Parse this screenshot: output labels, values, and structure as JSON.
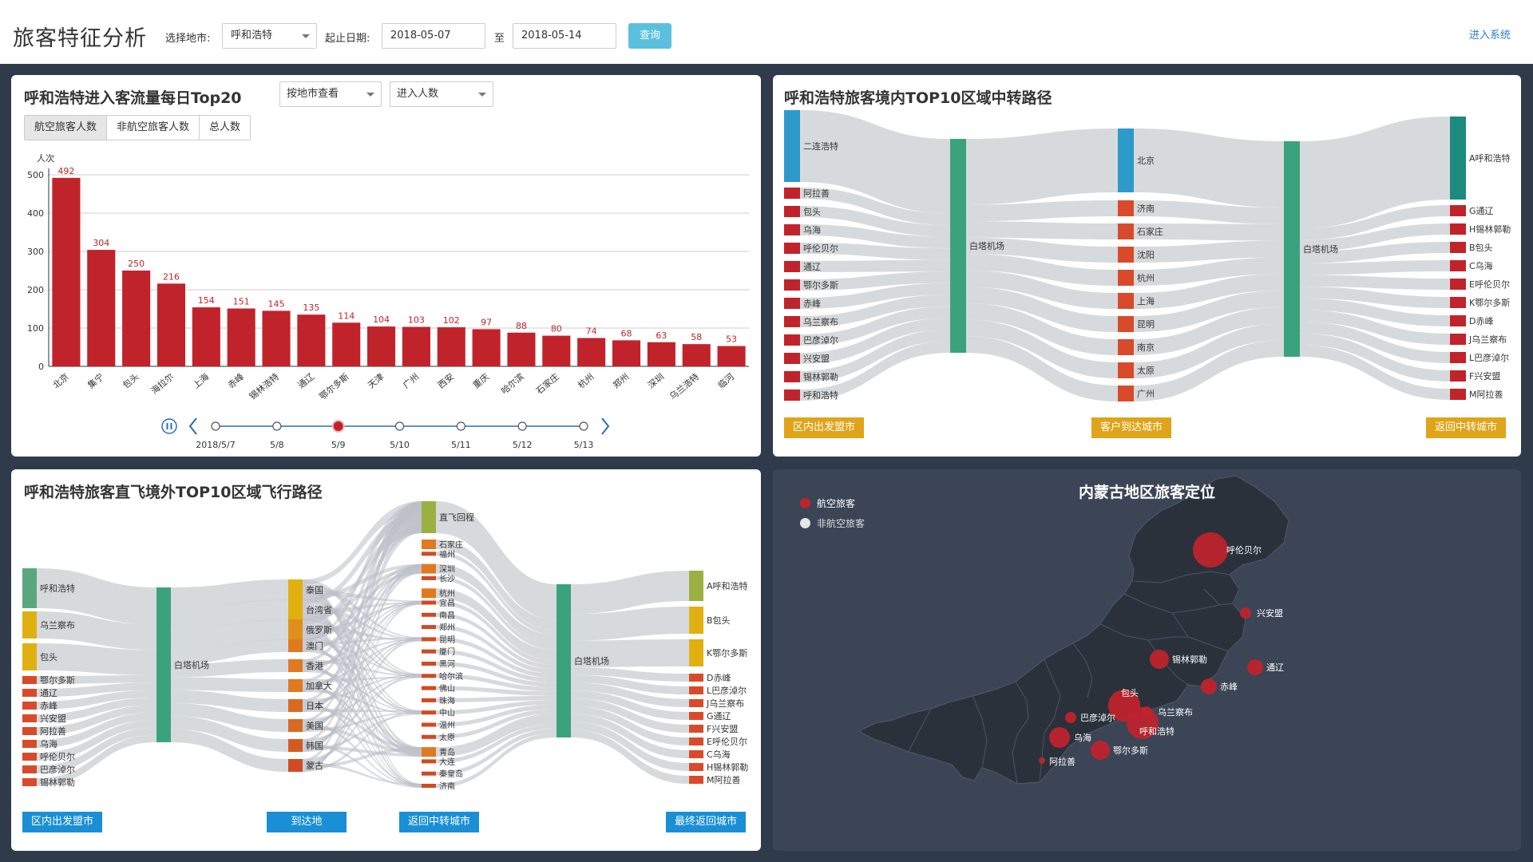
{
  "header": {
    "title": "旅客特征分析",
    "city_label": "选择地市:",
    "city_value": "呼和浩特",
    "date_label": "起止日期:",
    "date_start": "2018-05-07",
    "date_sep": "至",
    "date_end": "2018-05-14",
    "query_button": "查询",
    "enter_link": "进入系统"
  },
  "bar_panel": {
    "title": "呼和浩特进入客流量每日Top20",
    "select_view": "按地市查看",
    "select_metric": "进入人数",
    "buttons": [
      "航空旅客人数",
      "非航空旅客人数",
      "总人数"
    ]
  },
  "chart_data": {
    "type": "bar",
    "ylabel": "人次",
    "ylim": [
      0,
      500
    ],
    "yticks": [
      0,
      100,
      200,
      300,
      400,
      500
    ],
    "categories": [
      "北京",
      "集宁",
      "包头",
      "海拉尔",
      "上海",
      "赤峰",
      "锡林浩特",
      "通辽",
      "鄂尔多斯",
      "天津",
      "广州",
      "西安",
      "重庆",
      "哈尔滨",
      "石家庄",
      "杭州",
      "郑州",
      "深圳",
      "乌兰浩特",
      "临河"
    ],
    "values": [
      492,
      304,
      250,
      216,
      154,
      151,
      145,
      135,
      114,
      104,
      103,
      102,
      97,
      88,
      80,
      74,
      68,
      63,
      58,
      53
    ],
    "color": "#c1232b"
  },
  "timeline": {
    "labels": [
      "2018/5/7",
      "5/8",
      "5/9",
      "5/10",
      "5/11",
      "5/12",
      "5/13"
    ],
    "current_index": 2
  },
  "sankey1": {
    "title": "呼和浩特旅客境内TOP10区域中转路径",
    "col1": [
      "二连浩特",
      "阿拉善",
      "包头",
      "乌海",
      "呼伦贝尔",
      "通辽",
      "鄂尔多斯",
      "赤峰",
      "乌兰察布",
      "巴彦淖尔",
      "兴安盟",
      "锡林郭勒",
      "呼和浩特"
    ],
    "hub1": "白塔机场",
    "col2": [
      "北京",
      "济南",
      "石家庄",
      "沈阳",
      "杭州",
      "上海",
      "昆明",
      "南京",
      "太原",
      "广州"
    ],
    "hub2": "白塔机场",
    "col3": [
      "A呼和浩特",
      "G通辽",
      "H锡林郭勒",
      "B包头",
      "C乌海",
      "E呼伦贝尔",
      "K鄂尔多斯",
      "D赤峰",
      "J乌兰察布",
      "L巴彦淖尔",
      "F兴安盟",
      "M阿拉善"
    ],
    "tags": [
      "区内出发盟市",
      "客户到达城市",
      "返回中转城市"
    ],
    "colors": {
      "first": "#2e9ac9",
      "hub": "#3aa37d",
      "red": "#c1232b",
      "orange": "#d84b2a",
      "teal": "#1c8a7e",
      "tag": "#e0a41a"
    }
  },
  "sankey2": {
    "title": "呼和浩特旅客直飞境外TOP10区域飞行路径",
    "col1": [
      "呼和浩特",
      "乌兰察布",
      "包头",
      "鄂尔多斯",
      "通辽",
      "赤峰",
      "兴安盟",
      "阿拉善",
      "乌海",
      "呼伦贝尔",
      "巴彦淖尔",
      "锡林郭勒"
    ],
    "hub1": "白塔机场",
    "col2": [
      "泰国",
      "台湾省",
      "俄罗斯",
      "澳门",
      "香港",
      "加拿大",
      "日本",
      "美国",
      "韩国",
      "蒙古"
    ],
    "col3": [
      "直飞回程",
      "石家庄",
      "福州",
      "深圳",
      "长沙",
      "杭州",
      "宜昌",
      "南昌",
      "郑州",
      "昆明",
      "厦门",
      "黑河",
      "哈尔滨",
      "佛山",
      "珠海",
      "中山",
      "温州",
      "太原",
      "青岛",
      "大连",
      "秦皇岛",
      "济南"
    ],
    "hub2": "白塔机场",
    "col4": [
      "A呼和浩特",
      "B包头",
      "K鄂尔多斯",
      "D赤峰",
      "L巴彦淖尔",
      "J乌兰察布",
      "G通辽",
      "F兴安盟",
      "E呼伦贝尔",
      "C乌海",
      "H锡林郭勒",
      "M阿拉善"
    ],
    "tags": [
      "区内出发盟市",
      "到达地",
      "返回中转城市",
      "最终返回城市"
    ],
    "tag_color": "#1a8fd6"
  },
  "map_panel": {
    "title": "内蒙古地区旅客定位",
    "legend": [
      "航空旅客",
      "非航空旅客"
    ],
    "legend_colors": [
      "#c1232b",
      "#e6e6e6"
    ],
    "cities": [
      {
        "name": "呼伦贝尔",
        "size": "large"
      },
      {
        "name": "兴安盟",
        "size": "small"
      },
      {
        "name": "锡林郭勒",
        "size": "medium"
      },
      {
        "name": "通辽",
        "size": "medium"
      },
      {
        "name": "赤峰",
        "size": "medium"
      },
      {
        "name": "包头",
        "size": "large"
      },
      {
        "name": "乌兰察布",
        "size": "small"
      },
      {
        "name": "呼和浩特",
        "size": "large"
      },
      {
        "name": "巴彦淖尔",
        "size": "small"
      },
      {
        "name": "乌海",
        "size": "medium"
      },
      {
        "name": "鄂尔多斯",
        "size": "medium"
      },
      {
        "name": "阿拉善",
        "size": "tiny"
      }
    ]
  }
}
